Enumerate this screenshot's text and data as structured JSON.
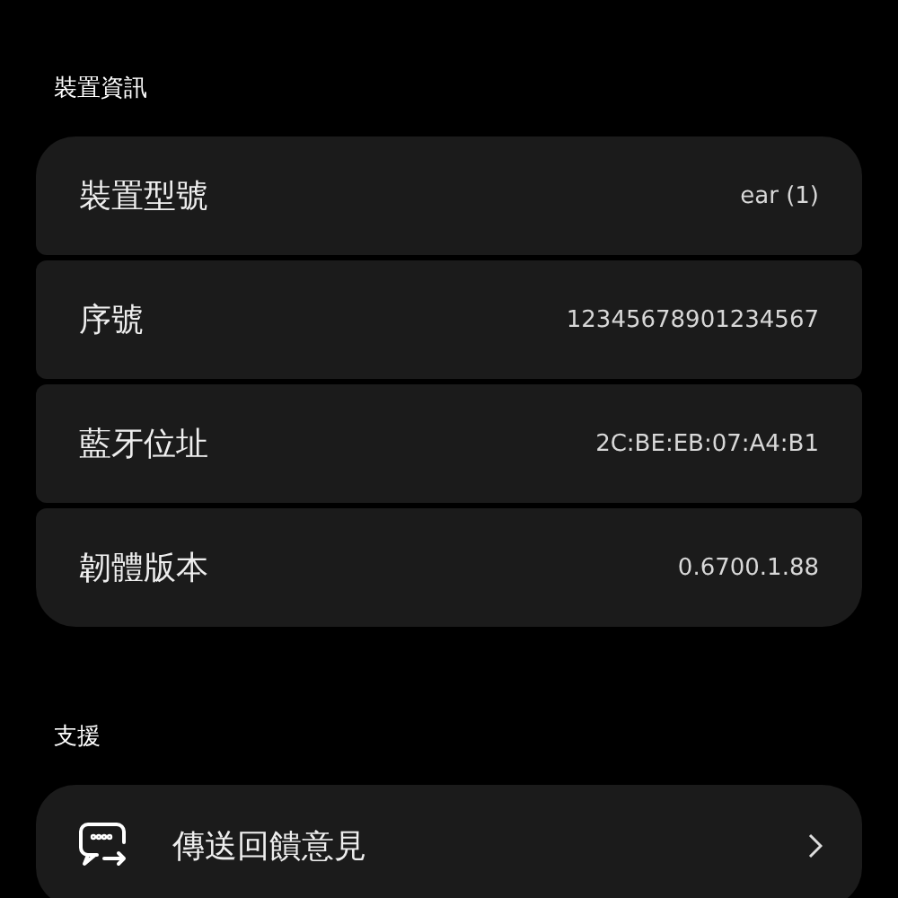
{
  "sections": [
    {
      "title": "裝置資訊",
      "rows": [
        {
          "kind": "info",
          "label": "裝置型號",
          "value": "ear (1)"
        },
        {
          "kind": "info",
          "label": "序號",
          "value": "12345678901234567"
        },
        {
          "kind": "info",
          "label": "藍牙位址",
          "value": "2C:BE:EB:07:A4:B1"
        },
        {
          "kind": "info",
          "label": "韌體版本",
          "value": "0.6700.1.88"
        }
      ]
    },
    {
      "title": "支援",
      "rows": [
        {
          "kind": "link",
          "label": "傳送回饋意見"
        }
      ]
    }
  ]
}
